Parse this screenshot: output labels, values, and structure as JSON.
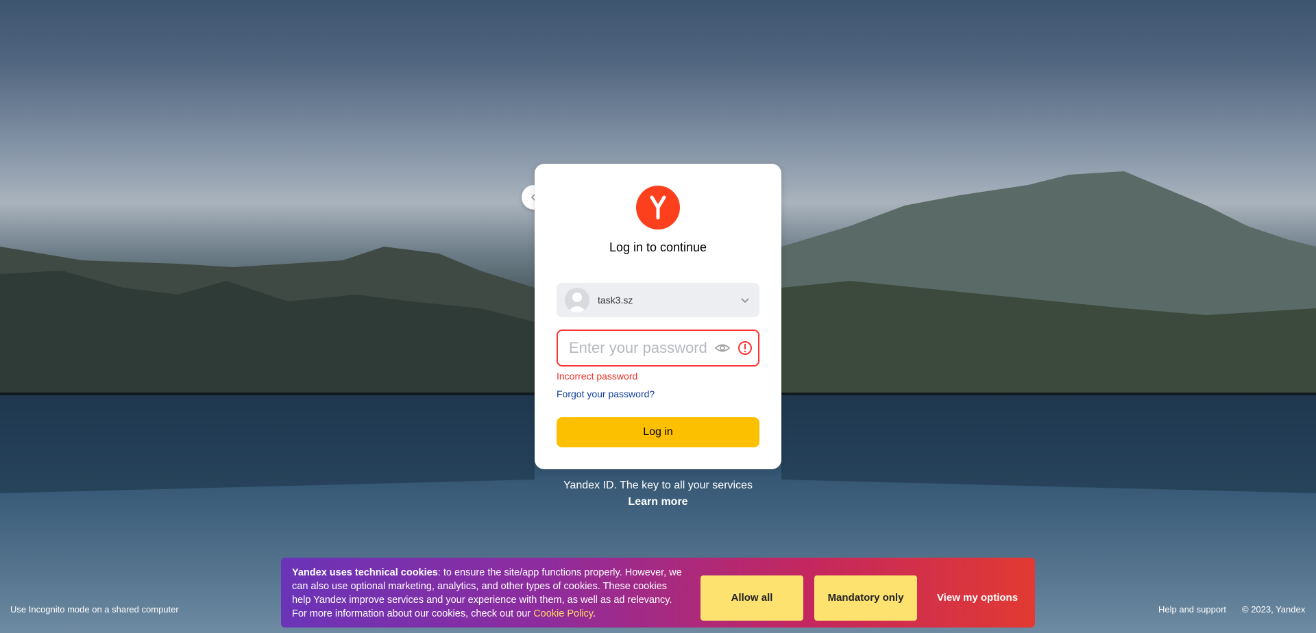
{
  "card": {
    "title": "Log in to continue",
    "account_name": "task3.sz",
    "password_placeholder": "Enter your password",
    "error_text": "Incorrect password",
    "forgot_link": "Forgot your password?",
    "login_button": "Log in"
  },
  "tagline": "Yandex ID. The key to all your services",
  "learn_more": "Learn more",
  "cookie": {
    "bold_text": "Yandex uses technical cookies",
    "body_text": ": to ensure the site/app functions properly. However, we can also use optional marketing, analytics, and other types of cookies. These cookies help Yandex improve services and your experience with them, as well as ad relevancy. For more information about our cookies, check out our ",
    "link_text": "Cookie Policy",
    "end_text": ".",
    "allow_all": "Allow all",
    "mandatory_only": "Mandatory only",
    "view_options": "View my options"
  },
  "footer": {
    "incognito": "Use Incognito mode on a shared computer",
    "help": "Help and support",
    "copyright": "© 2023, Yandex"
  },
  "colors": {
    "brand_red": "#fc3f1d",
    "button_yellow": "#fcc000",
    "error_red": "#e8322a",
    "link_blue": "#0f3c9f"
  },
  "icons": [
    "back-arrow-icon",
    "yandex-logo-icon",
    "chevron-down-icon",
    "eye-icon",
    "warning-icon"
  ]
}
